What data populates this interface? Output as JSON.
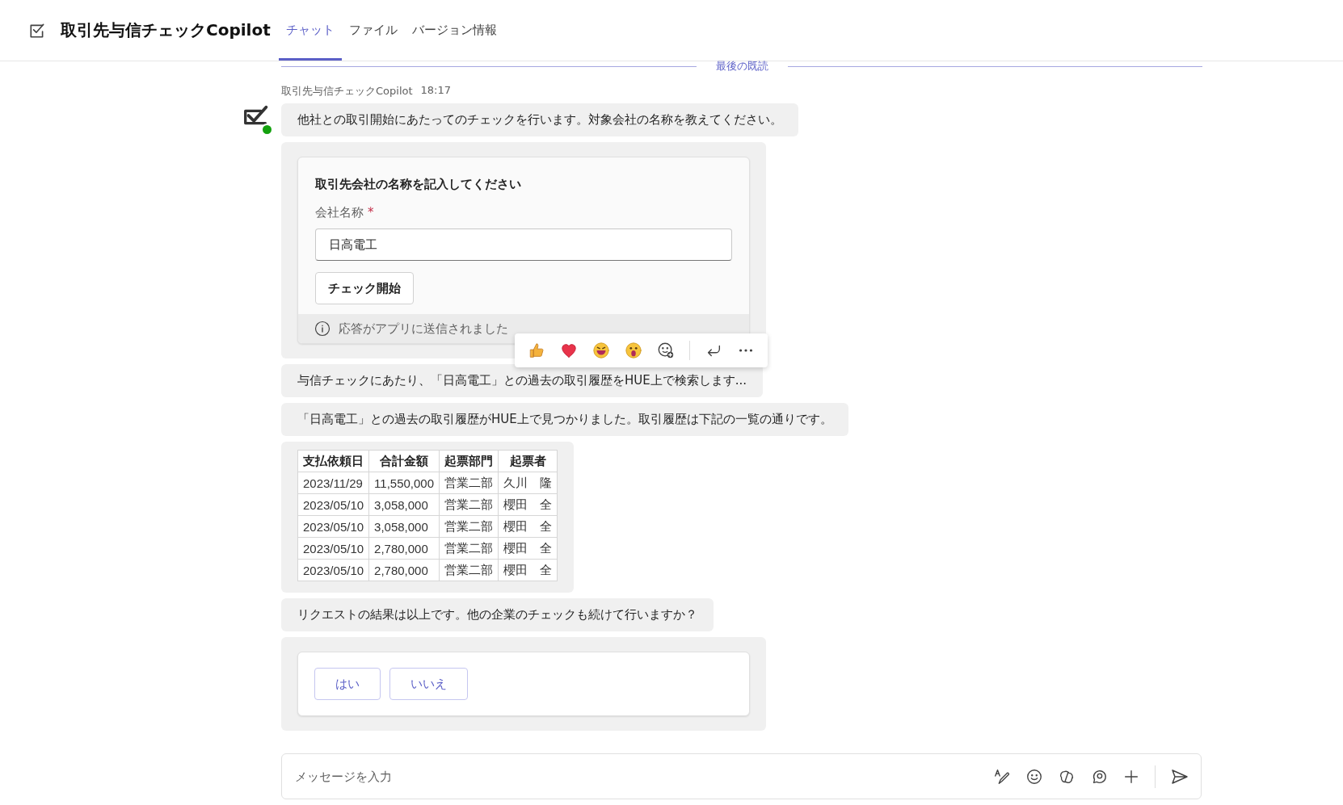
{
  "header": {
    "title": "取引先与信チェックCopilot",
    "tabs": [
      {
        "label": "チャット",
        "selected": true
      },
      {
        "label": "ファイル",
        "selected": false
      },
      {
        "label": "バージョン情報",
        "selected": false
      }
    ]
  },
  "divider_label": "最後の既読",
  "message": {
    "sender": "取引先与信チェックCopilot",
    "time": "18:17",
    "online": true
  },
  "items": [
    {
      "kind": "text",
      "text": "他社との取引開始にあたってのチェックを行います。対象会社の名称を教えてください。"
    },
    {
      "kind": "form",
      "title": "取引先会社の名称を記入してください",
      "field_label": "会社名称",
      "required_mark": "*",
      "value": "日高電工",
      "button": "チェック開始",
      "footer": "応答がアプリに送信されました"
    },
    {
      "kind": "text",
      "text": "与信チェックにあたり、「日高電工」との過去の取引履歴をHUE上で検索します..."
    },
    {
      "kind": "text",
      "text": "「日高電工」との過去の取引履歴がHUE上で見つかりました。取引履歴は下記の一覧の通りです。"
    },
    {
      "kind": "table",
      "columns": [
        "支払依頼日",
        "合計金額",
        "起票部門",
        "起票者"
      ],
      "rows": [
        [
          "2023/11/29",
          "11,550,000",
          "営業二部",
          "久川　隆"
        ],
        [
          "2023/05/10",
          "3,058,000",
          "営業二部",
          "櫻田　全"
        ],
        [
          "2023/05/10",
          "3,058,000",
          "営業二部",
          "櫻田　全"
        ],
        [
          "2023/05/10",
          "2,780,000",
          "営業二部",
          "櫻田　全"
        ],
        [
          "2023/05/10",
          "2,780,000",
          "営業二部",
          "櫻田　全"
        ]
      ]
    },
    {
      "kind": "text",
      "text": "リクエストの結果は以上です。他の企業のチェックも続けて行いますか？"
    },
    {
      "kind": "choices",
      "buttons": [
        "はい",
        "いいえ"
      ]
    }
  ],
  "compose": {
    "placeholder": "メッセージを入力"
  }
}
